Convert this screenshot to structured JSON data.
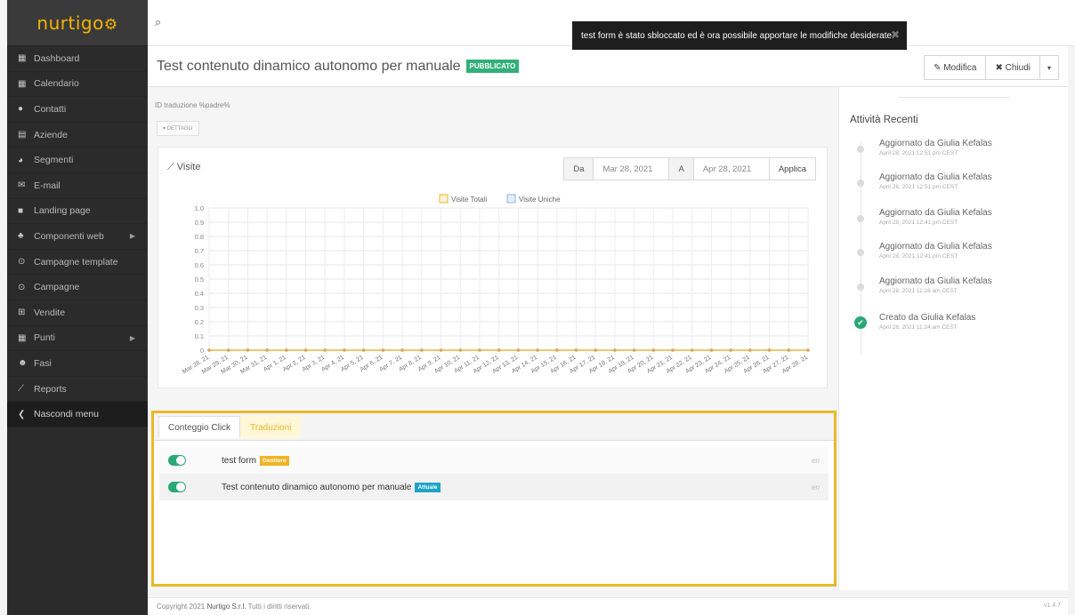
{
  "sidebar": {
    "logo": "nurtigo",
    "items": [
      {
        "icon": "dashboard-icon",
        "glyph": "▦",
        "label": "Dashboard",
        "arrow": false
      },
      {
        "icon": "calendar-icon",
        "glyph": "▦",
        "label": "Calendario",
        "arrow": false
      },
      {
        "icon": "user-icon",
        "glyph": "●",
        "label": "Contatti",
        "arrow": false
      },
      {
        "icon": "building-icon",
        "glyph": "▤",
        "label": "Aziende",
        "arrow": false
      },
      {
        "icon": "pie-chart-icon",
        "glyph": "◕",
        "label": "Segmenti",
        "arrow": false
      },
      {
        "icon": "envelope-icon",
        "glyph": "✉",
        "label": "E-mail",
        "arrow": false
      },
      {
        "icon": "file-icon",
        "glyph": "■",
        "label": "Landing page",
        "arrow": false
      },
      {
        "icon": "puzzle-icon",
        "glyph": "♣",
        "label": "Componenti web",
        "arrow": true
      },
      {
        "icon": "clock-icon",
        "glyph": "⊙",
        "label": "Campagne template",
        "arrow": false
      },
      {
        "icon": "clock-icon",
        "glyph": "⊙",
        "label": "Campagne",
        "arrow": false
      },
      {
        "icon": "cart-icon",
        "glyph": "⊞",
        "label": "Vendite",
        "arrow": false
      },
      {
        "icon": "calculator-icon",
        "glyph": "▦",
        "label": "Punti",
        "arrow": true
      },
      {
        "icon": "users-icon",
        "glyph": "☻",
        "label": "Fasi",
        "arrow": false
      },
      {
        "icon": "line-chart-icon",
        "glyph": "⟋",
        "label": "Reports",
        "arrow": false
      },
      {
        "icon": "chevron-left-icon",
        "glyph": "❮",
        "label": "Nascondi menu",
        "arrow": false
      }
    ]
  },
  "toast": {
    "message": "test form è stato sbloccato ed è ora possibile apportare le modifiche desiderate."
  },
  "header": {
    "title": "Test contenuto dinamico autonomo per manuale",
    "status": "PUBBLICATO",
    "edit_label": "✎ Modifica",
    "close_label": "✖ Chiudi",
    "caret": "▾"
  },
  "details": {
    "id_label": "ID traduzione %padre%",
    "toggle_label": "▾ DETTAGLI"
  },
  "chart_panel": {
    "title": "Visite",
    "from_label": "Da",
    "from_value": "Mar 28, 2021",
    "to_label": "A",
    "to_value": "Apr 28, 2021",
    "apply_label": "Applica"
  },
  "chart_data": {
    "type": "line",
    "x": [
      "Mar 28, 21",
      "Mar 29, 21",
      "Mar 30, 21",
      "Mar 31, 21",
      "Apr 1, 21",
      "Apr 2, 21",
      "Apr 3, 21",
      "Apr 4, 21",
      "Apr 5, 21",
      "Apr 6, 21",
      "Apr 7, 21",
      "Apr 8, 21",
      "Apr 9, 21",
      "Apr 10, 21",
      "Apr 11, 21",
      "Apr 12, 21",
      "Apr 13, 21",
      "Apr 14, 21",
      "Apr 15, 21",
      "Apr 16, 21",
      "Apr 17, 21",
      "Apr 18, 21",
      "Apr 19, 21",
      "Apr 20, 21",
      "Apr 21, 21",
      "Apr 22, 21",
      "Apr 23, 21",
      "Apr 24, 21",
      "Apr 25, 21",
      "Apr 26, 21",
      "Apr 27, 21",
      "Apr 28, 21"
    ],
    "series": [
      {
        "name": "Visite Totali",
        "color": "#f0b322",
        "values": [
          0,
          0,
          0,
          0,
          0,
          0,
          0,
          0,
          0,
          0,
          0,
          0,
          0,
          0,
          0,
          0,
          0,
          0,
          0,
          0,
          0,
          0,
          0,
          0,
          0,
          0,
          0,
          0,
          0,
          0,
          0,
          0
        ]
      },
      {
        "name": "Visite Uniche",
        "color": "#8fb3d9",
        "values": [
          0,
          0,
          0,
          0,
          0,
          0,
          0,
          0,
          0,
          0,
          0,
          0,
          0,
          0,
          0,
          0,
          0,
          0,
          0,
          0,
          0,
          0,
          0,
          0,
          0,
          0,
          0,
          0,
          0,
          0,
          0,
          0
        ]
      }
    ],
    "yticks": [
      "0",
      "0.1",
      "0.2",
      "0.3",
      "0.4",
      "0.5",
      "0.6",
      "0.7",
      "0.8",
      "0.9",
      "1.0"
    ],
    "ylim": [
      0,
      1
    ],
    "grid": true,
    "legend": "top-center"
  },
  "tabs": [
    {
      "label": "Conteggio Click"
    },
    {
      "label": "Traduzioni"
    }
  ],
  "translations": [
    {
      "name": "test form",
      "tag": "Genitore",
      "lang": "en"
    },
    {
      "name": "Test contenuto dinamico autonomo per manuale",
      "tag": "Attuale",
      "lang": "en"
    }
  ],
  "activity": {
    "title": "Attività Recenti",
    "items": [
      {
        "text": "Aggiornato da Giulia Kefalas",
        "time": "April 28, 2021 12:51 pm CEST",
        "type": "update"
      },
      {
        "text": "Aggiornato da Giulia Kefalas",
        "time": "April 28, 2021 12:51 pm CEST",
        "type": "update"
      },
      {
        "text": "Aggiornato da Giulia Kefalas",
        "time": "April 28, 2021 12:41 pm CEST",
        "type": "update"
      },
      {
        "text": "Aggiornato da Giulia Kefalas",
        "time": "April 28, 2021 12:41 pm CEST",
        "type": "update"
      },
      {
        "text": "Aggiornato da Giulia Kefalas",
        "time": "April 28, 2021 11:28 am CEST",
        "type": "update"
      },
      {
        "text": "Creato da Giulia Kefalas",
        "time": "April 28, 2021 11:24 am CEST",
        "type": "create"
      }
    ]
  },
  "footer": {
    "prefix": "Copyright 2021 ",
    "company": "Nurtigo S.r.l.",
    "suffix": " Tutti i diritti riservati.",
    "version": "v1.4.7"
  }
}
